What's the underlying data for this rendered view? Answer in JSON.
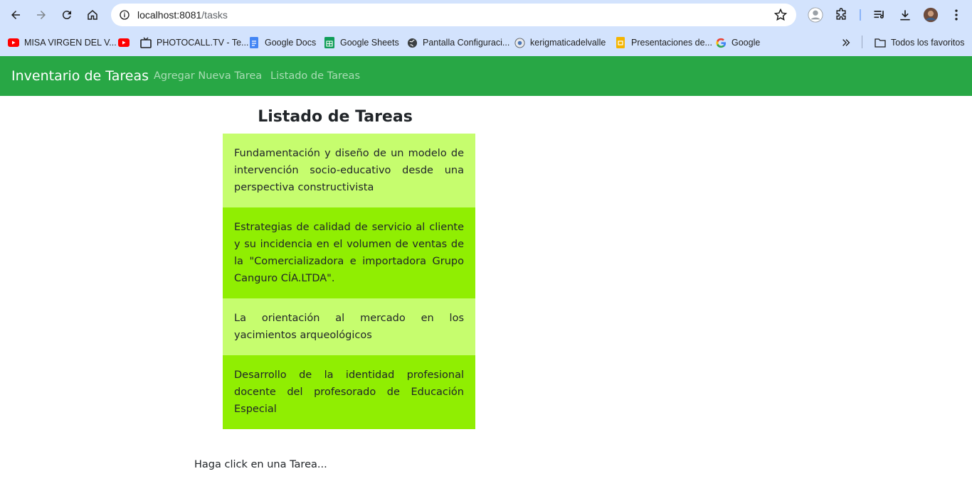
{
  "browser": {
    "url_host": "localhost:8081",
    "url_path": "/tasks",
    "bookmarks": [
      {
        "label": "MISA VIRGEN DEL V...",
        "icon": "youtube-icon"
      },
      {
        "label": "",
        "icon": "youtube-icon"
      },
      {
        "label": "PHOTOCALL.TV - Te...",
        "icon": "tv-icon"
      },
      {
        "label": "Google Docs",
        "icon": "google-docs-icon"
      },
      {
        "label": "Google Sheets",
        "icon": "google-sheets-icon"
      },
      {
        "label": "Pantalla Configuraci...",
        "icon": "globe-icon"
      },
      {
        "label": "kerigmaticadelvalle",
        "icon": "site-icon"
      },
      {
        "label": "Presentaciones de...",
        "icon": "google-slides-icon"
      },
      {
        "label": "Google",
        "icon": "google-icon"
      }
    ],
    "all_bookmarks_label": "Todos los favoritos"
  },
  "navbar": {
    "brand": "Inventario de Tareas",
    "links": [
      "Agregar Nueva Tarea",
      "Listado de Tareas"
    ],
    "color": "#28a745"
  },
  "main": {
    "title": "Listado de Tareas",
    "tasks": [
      "Fundamentación y diseño de un modelo de intervención socio-educativo desde una perspectiva constructivista",
      "Estrategias de calidad de servicio al cliente y su incidencia en el volumen de ventas de la \"Comercializadora e importadora Grupo Canguro CÍA.LTDA\".",
      "La orientación al mercado en los yacimientos arqueológicos",
      "Desarrollo de la identidad profesional docente del profesorado de Educación Especial"
    ],
    "task_colors": [
      "#c6fd6e",
      "#90ee02"
    ],
    "hint": "Haga click en una Tarea..."
  }
}
